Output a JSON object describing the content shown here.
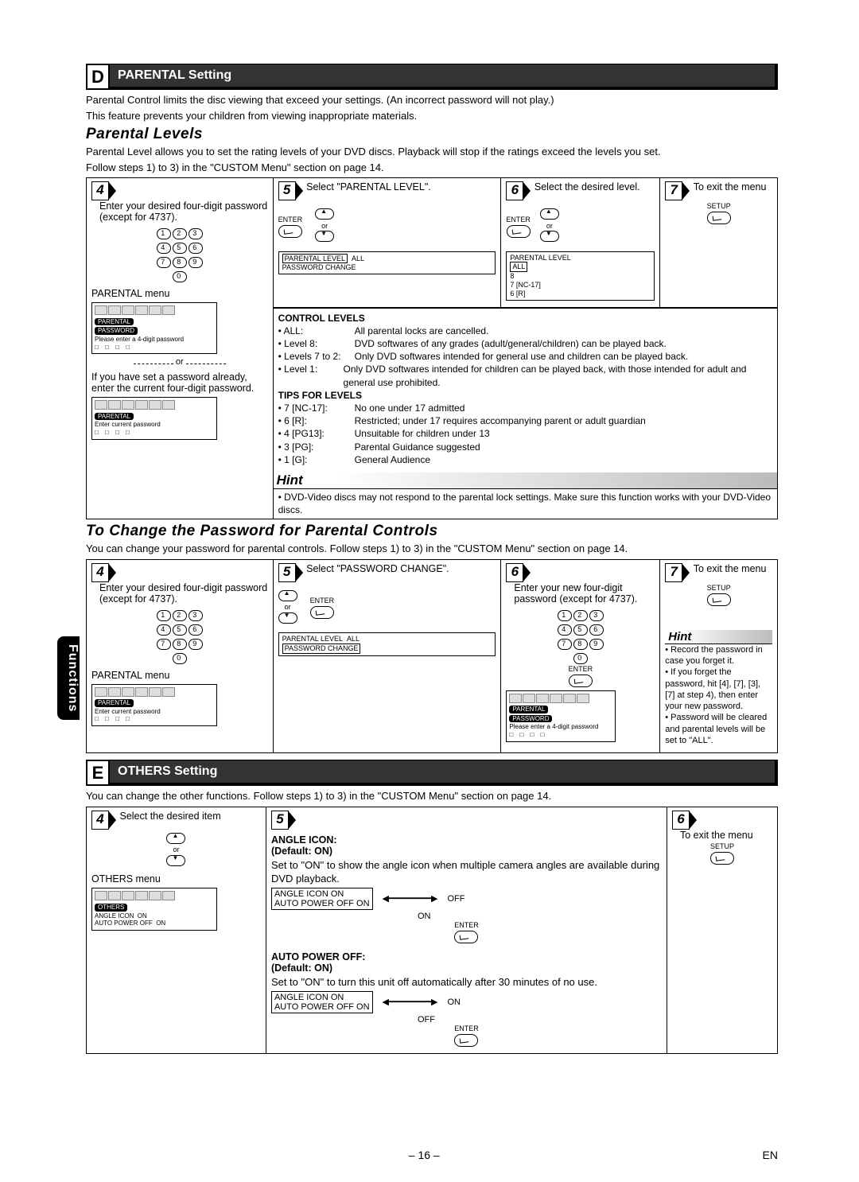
{
  "sidebar_tab": "Functions",
  "sectionD": {
    "letter": "D",
    "title": "PARENTAL Setting",
    "intro1": "Parental Control limits the disc viewing that exceed your settings. (An incorrect password will not play.)",
    "intro2": "This feature prevents your children from viewing inappropriate materials.",
    "sub1": "Parental Levels",
    "sub1_intro1": "Parental Level allows you to set the rating levels of your DVD discs. Playback will stop if the ratings exceed the levels you set.",
    "sub1_intro2": "Follow steps 1) to 3) in the \"CUSTOM Menu\" section on page 14.",
    "step4": {
      "num": "4",
      "text": "Enter your desired four-digit password (except for 4737).",
      "menu_label": "PARENTAL menu",
      "screen_tag": "PARENTAL",
      "screen_sub": "PASSWORD",
      "screen_msg": "Please enter a 4-digit password",
      "or": "or",
      "alt": "If you have set a password already, enter the current four-digit password.",
      "alt_msg": "Enter current password"
    },
    "step5": {
      "num": "5",
      "text": "Select \"PARENTAL LEVEL\".",
      "enter": "ENTER",
      "list1": "PARENTAL LEVEL",
      "list1v": "ALL",
      "list2": "PASSWORD CHANGE"
    },
    "step6": {
      "num": "6",
      "text": "Select the desired level.",
      "enter": "ENTER",
      "list_title": "PARENTAL LEVEL",
      "items": [
        "ALL",
        "8",
        "7 [NC-17]",
        "6 [R]"
      ]
    },
    "step7": {
      "num": "7",
      "text": "To exit the menu",
      "setup": "SETUP"
    },
    "control": {
      "title": "CONTROL LEVELS",
      "rows": [
        {
          "k": "• ALL:",
          "v": "All parental locks are cancelled."
        },
        {
          "k": "• Level 8:",
          "v": "DVD softwares of any grades (adult/general/children) can be played back."
        },
        {
          "k": "• Levels 7 to 2:",
          "v": "Only DVD softwares intended for general use and children can be played back."
        },
        {
          "k": "• Level 1:",
          "v": "Only DVD softwares intended for children can be played back, with those intended for adult and general use prohibited."
        }
      ],
      "tips_title": "TIPS FOR LEVELS",
      "tips": [
        {
          "k": "• 7 [NC-17]:",
          "v": "No one under 17 admitted"
        },
        {
          "k": "• 6 [R]:",
          "v": "Restricted; under 17 requires accompanying parent or adult guardian"
        },
        {
          "k": "• 4 [PG13]:",
          "v": "Unsuitable for children under 13"
        },
        {
          "k": "• 3 [PG]:",
          "v": "Parental Guidance suggested"
        },
        {
          "k": "• 1 [G]:",
          "v": "General Audience"
        }
      ]
    },
    "hint_title": "Hint",
    "hint_body": "• DVD-Video discs may not respond to the parental lock settings. Make sure this function works with your DVD-Video discs.",
    "sub2": "To Change the Password for Parental Controls",
    "sub2_intro": "You can change your password for parental controls. Follow steps 1) to 3) in the \"CUSTOM Menu\" section on page 14.",
    "pw4": {
      "num": "4",
      "text": "Enter your desired four-digit password (except for 4737).",
      "menu_label": "PARENTAL menu",
      "alt_msg": "Enter current password"
    },
    "pw5": {
      "num": "5",
      "text": "Select \"PASSWORD CHANGE\".",
      "enter": "ENTER",
      "list1": "PARENTAL LEVEL",
      "list1v": "ALL",
      "list2": "PASSWORD CHANGE"
    },
    "pw6": {
      "num": "6",
      "text": "Enter your new four-digit password (except for 4737).",
      "enter": "ENTER",
      "screen_tag": "PARENTAL",
      "screen_sub": "PASSWORD",
      "screen_msg": "Please enter a 4-digit password"
    },
    "pw7": {
      "num": "7",
      "text": "To exit the menu",
      "setup": "SETUP"
    },
    "hint2_title": "Hint",
    "hint2": [
      "• Record the password in case you forget it.",
      "• If you forget the password, hit [4], [7], [3], [7] at step 4), then enter your new password.",
      "• Password will be cleared and parental levels will be set to \"ALL\"."
    ]
  },
  "sectionE": {
    "letter": "E",
    "title": "OTHERS Setting",
    "intro": "You can change the other functions. Follow steps 1) to 3) in the \"CUSTOM Menu\" section on page 14.",
    "step4": {
      "num": "4",
      "text": "Select the desired item",
      "menu_label": "OTHERS menu",
      "screen_tag": "OTHERS",
      "row1": "ANGLE ICON",
      "row1v": "ON",
      "row2": "AUTO POWER OFF",
      "row2v": "ON"
    },
    "step5": {
      "num": "5",
      "angle_title": "ANGLE ICON:",
      "angle_def": "(Default: ON)",
      "angle_desc": "Set to \"ON\" to show the angle icon when multiple camera angles are available during DVD playback.",
      "angle_opts": {
        "l1": "ANGLE ICON",
        "v1": "ON",
        "r1": "OFF",
        "l2": "AUTO POWER OFF",
        "v2": "ON",
        "r2": "ON"
      },
      "enter": "ENTER",
      "apo_title": "AUTO POWER OFF:",
      "apo_def": "(Default: ON)",
      "apo_desc": "Set to \"ON\" to turn this unit off automatically after 30 minutes of no use.",
      "apo_opts": {
        "l1": "ANGLE ICON",
        "v1": "ON",
        "r1": "ON",
        "l2": "AUTO POWER OFF",
        "v2": "ON",
        "r2": "OFF"
      }
    },
    "step6": {
      "num": "6",
      "text": "To exit the menu",
      "setup": "SETUP"
    }
  },
  "footer": {
    "page": "– 16 –",
    "lang": "EN"
  }
}
